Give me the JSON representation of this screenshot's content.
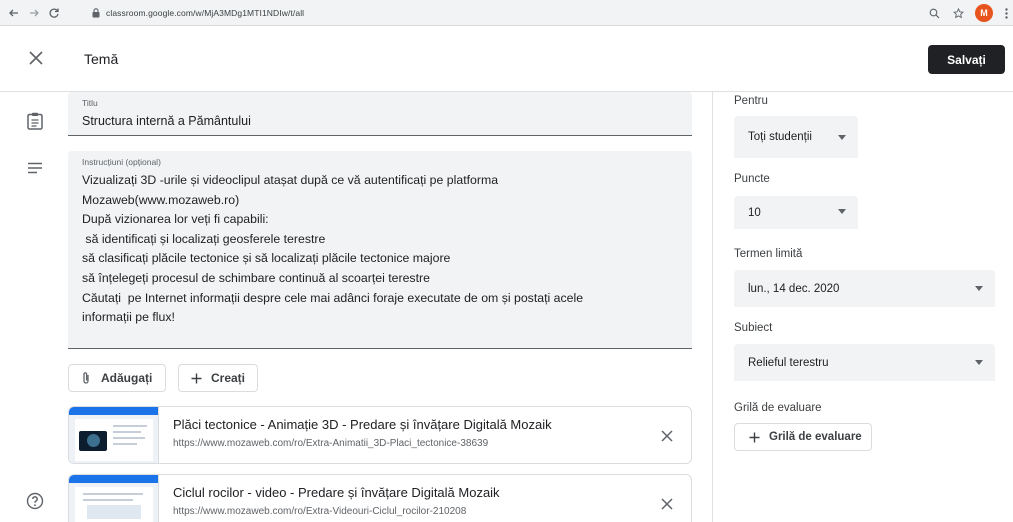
{
  "browser": {
    "url": "classroom.google.com/w/MjA3MDg1MTI1NDIw/t/all",
    "avatar_letter": "M",
    "avatar_color": "#e8541e"
  },
  "header": {
    "title": "Temă",
    "save_label": "Salvați"
  },
  "title_field": {
    "label": "Titlu",
    "value": "Structura internă a Pământului"
  },
  "instructions_field": {
    "label": "Instrucțiuni (opțional)",
    "lines": [
      "Vizualizați 3D -urile și videoclipul atașat după ce vă autentificați pe platforma",
      "Mozaweb(www.mozaweb.ro)",
      "După vizionarea lor veți fi capabili:",
      " să identificați și localizați geosferele terestre",
      "să clasificați plăcile tectonice și să localizați plăcile tectonice majore",
      "să înțelegeți procesul de schimbare continuă al scoarței terestre",
      "Căutați  pe Internet informații despre cele mai adânci foraje executate de om și postați acele",
      "informații pe flux!"
    ]
  },
  "actions": {
    "add_label": "Adăugați",
    "create_label": "Creați"
  },
  "attachments": [
    {
      "title": "Plăci tectonice - Animație 3D - Predare și învățare Digitală Mozaik",
      "url": "https://www.mozaweb.com/ro/Extra-Animatii_3D-Placi_tectonice-38639"
    },
    {
      "title": "Ciclul rocilor - video - Predare și învățare Digitală Mozaik",
      "url": "https://www.mozaweb.com/ro/Extra-Videouri-Ciclul_rocilor-210208"
    }
  ],
  "right_panel": {
    "for_label": "Pentru",
    "for_value": "Toți studenții",
    "points_label": "Puncte",
    "points_value": "10",
    "due_label": "Termen limită",
    "due_value": "lun., 14 dec. 2020",
    "topic_label": "Subiect",
    "topic_value": "Relieful terestru",
    "rubric_label": "Grilă de evaluare",
    "rubric_button": "Grilă de evaluare"
  }
}
